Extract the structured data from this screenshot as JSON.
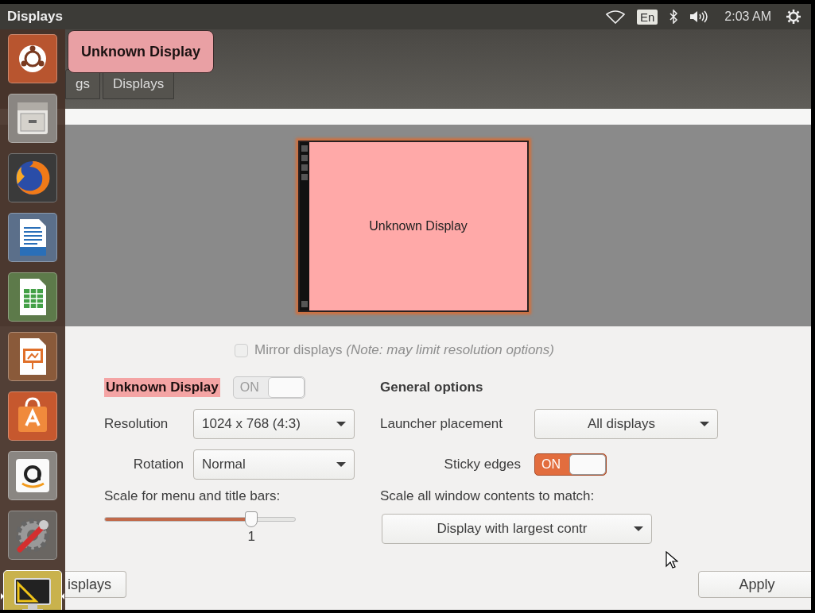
{
  "top_bar": {
    "title": "Displays",
    "language": "En",
    "clock": "2:03 AM"
  },
  "launcher": {
    "items": [
      {
        "kind": "logo",
        "active": false
      },
      {
        "kind": "files",
        "active": false
      },
      {
        "kind": "browser",
        "active": false
      },
      {
        "kind": "writer",
        "active": false
      },
      {
        "kind": "calc",
        "active": false
      },
      {
        "kind": "impress",
        "active": false
      },
      {
        "kind": "store",
        "active": false
      },
      {
        "kind": "shop",
        "active": false
      },
      {
        "kind": "settings",
        "active": false
      },
      {
        "kind": "displays",
        "active": true
      }
    ]
  },
  "tooltip": "Unknown Display",
  "breadcrumbs": [
    {
      "label": "gs"
    },
    {
      "label": "Displays"
    }
  ],
  "preview": {
    "monitor_label": "Unknown Display"
  },
  "mirror": {
    "label": "Mirror displays *(Note: may limit resolution options)*",
    "checked": false,
    "disabled": true
  },
  "display": {
    "name": "Unknown Display",
    "power": {
      "label": "ON",
      "on": true,
      "disabled": true
    },
    "resolution": {
      "label": "Resolution",
      "value": "1024 x 768 (4:3)"
    },
    "rotation": {
      "label": "Rotation",
      "value": "Normal"
    },
    "scale": {
      "label": "Scale for menu and title bars:",
      "level": 0.77,
      "value": "1"
    }
  },
  "general": {
    "heading": "General options",
    "launcher_placement": {
      "label": "Launcher placement",
      "value": "All displays"
    },
    "sticky_edges": {
      "label": "Sticky edges",
      "toggle_label": "ON",
      "on": true,
      "disabled": false
    },
    "scale_all": {
      "label": "Scale all window contents to match:",
      "value": "Display with largest contr"
    }
  },
  "buttons": [
    {
      "label": "isplays"
    },
    {
      "label": "Apply"
    }
  ]
}
